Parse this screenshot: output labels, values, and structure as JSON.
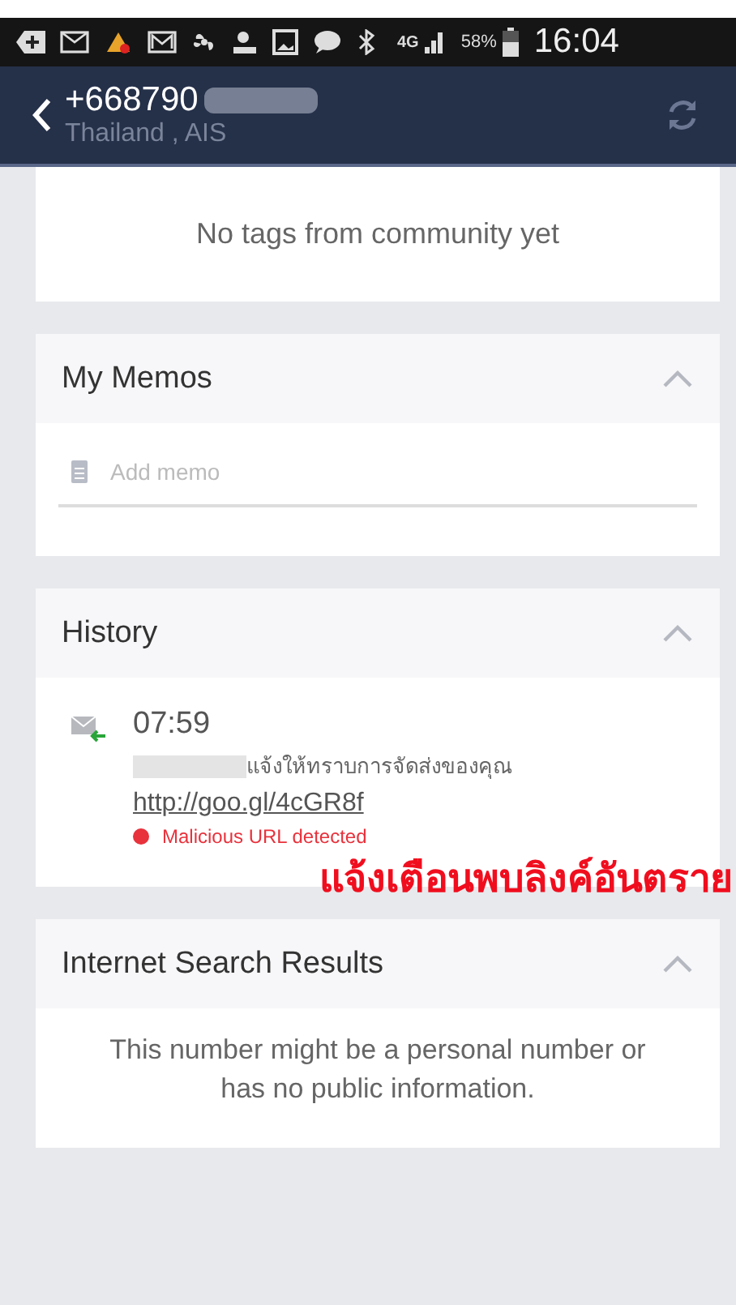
{
  "status_bar": {
    "network": "4G",
    "battery": "58%",
    "time": "16:04"
  },
  "header": {
    "title": "+668790",
    "subtitle": "Thailand , AIS"
  },
  "tags_card": {
    "text": "No tags from community yet"
  },
  "sections": [
    {
      "kind": "memos",
      "title": "My Memos",
      "expanded": true,
      "placeholder": "Add memo"
    },
    {
      "kind": "history",
      "title": "History",
      "expanded": true,
      "time": "07:59",
      "message": "แจ้งให้ทราบการจัดส่งของคุณ",
      "link": "http://goo.gl/4cGR8f",
      "warning": "Malicious URL detected",
      "color": "#e8323c"
    },
    {
      "kind": "search",
      "title": "Internet Search Results",
      "expanded": true,
      "text": "This number might be a personal number or has no public information."
    }
  ],
  "caption": "แจ้งเตือนพบลิงค์อันตราย"
}
